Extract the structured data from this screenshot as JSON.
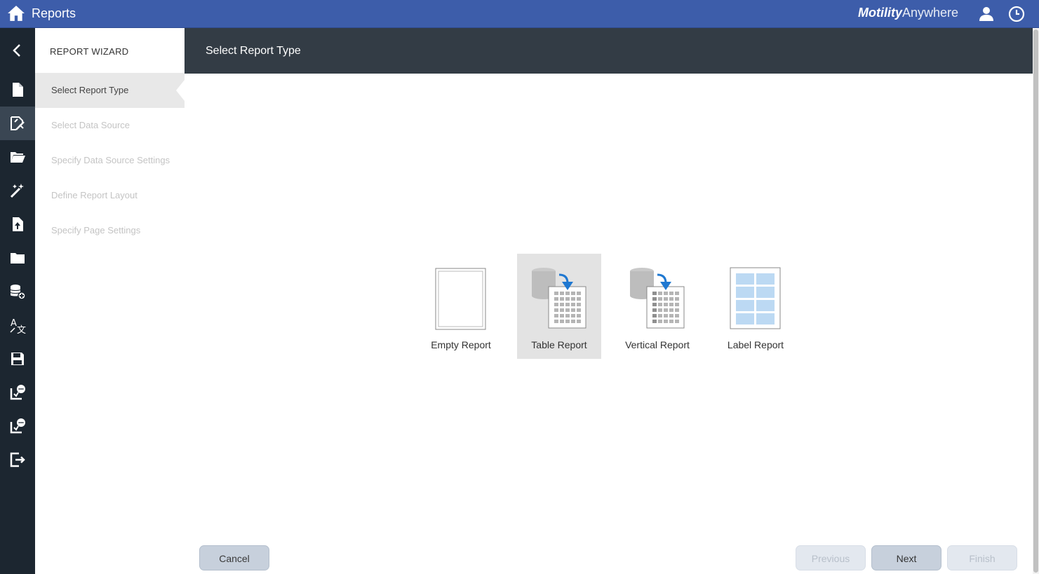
{
  "app": {
    "title": "Reports",
    "brand_bold": "Motility",
    "brand_light": "Anywhere"
  },
  "colors": {
    "topbar": "#3d5daa",
    "rail": "#1c2630",
    "header": "#333c45",
    "accent_arrow": "#1f78d1"
  },
  "rail": {
    "icons": [
      "back-arrow-icon",
      "document-icon",
      "report-wizard-icon",
      "open-folder-icon",
      "magic-wand-icon",
      "upload-icon",
      "folder-icon",
      "database-add-icon",
      "translate-icon",
      "save-icon",
      "report-comment-icon",
      "report-comment-alt-icon",
      "exit-icon"
    ]
  },
  "wizard": {
    "title": "REPORT WIZARD",
    "steps": [
      {
        "label": "Select Report Type",
        "state": "current"
      },
      {
        "label": "Select Data Source",
        "state": "disabled"
      },
      {
        "label": "Specify Data Source Settings",
        "state": "disabled"
      },
      {
        "label": "Define Report Layout",
        "state": "disabled"
      },
      {
        "label": "Specify Page Settings",
        "state": "disabled"
      }
    ]
  },
  "header": {
    "title": "Select Report Type"
  },
  "report_types": [
    {
      "label": "Empty Report",
      "selected": false
    },
    {
      "label": "Table Report",
      "selected": true
    },
    {
      "label": "Vertical Report",
      "selected": false
    },
    {
      "label": "Label Report",
      "selected": false
    }
  ],
  "buttons": {
    "cancel": "Cancel",
    "previous": "Previous",
    "next": "Next",
    "finish": "Finish"
  }
}
